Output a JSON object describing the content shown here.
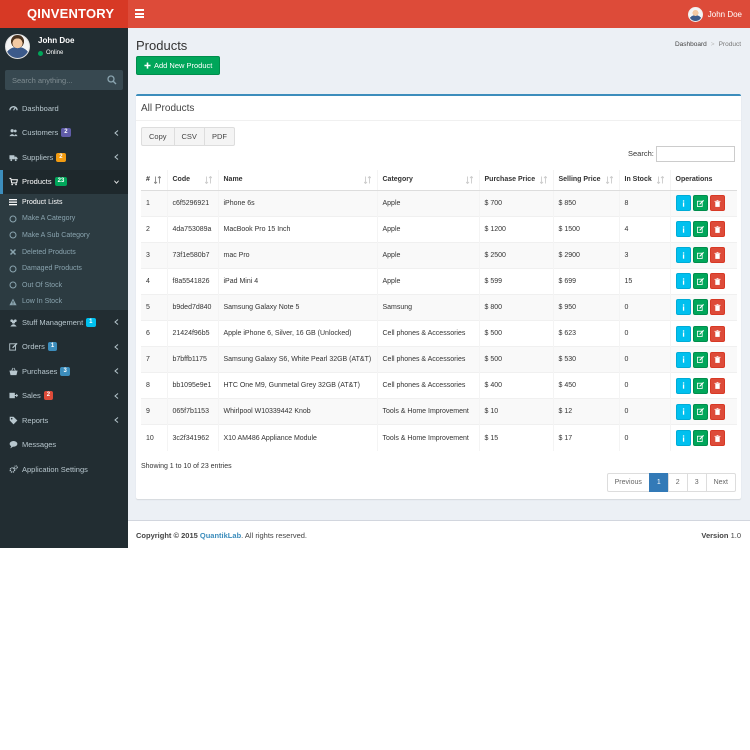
{
  "app": {
    "logo": "QINVENTORY",
    "user_name": "John Doe"
  },
  "sidebar": {
    "user": {
      "name": "John Doe",
      "status": "Online"
    },
    "search": {
      "placeholder": "Search anything..."
    },
    "menu": [
      {
        "label": "Dashboard",
        "icon": "dashboard-icon"
      },
      {
        "label": "Customers",
        "icon": "users-icon",
        "badge": "2",
        "badge_color": "#605ca8"
      },
      {
        "label": "Suppliers",
        "icon": "truck-icon",
        "badge": "2",
        "badge_color": "#f39c12"
      },
      {
        "label": "Products",
        "icon": "shopping-cart-icon",
        "badge": "23",
        "badge_color": "#00a65a"
      },
      {
        "label": "Stuff Management",
        "icon": "user-group-icon",
        "badge": "1",
        "badge_color": "#00c0ef"
      },
      {
        "label": "Orders",
        "icon": "edit-icon",
        "badge": "1",
        "badge_color": "#3c8dbc"
      },
      {
        "label": "Purchases",
        "icon": "basket-icon",
        "badge": "3",
        "badge_color": "#3c8dbc"
      },
      {
        "label": "Sales",
        "icon": "sales-icon",
        "badge": "2",
        "badge_color": "#dd4b39"
      },
      {
        "label": "Reports",
        "icon": "tag-icon"
      },
      {
        "label": "Messages",
        "icon": "chat-icon"
      },
      {
        "label": "Application Settings",
        "icon": "cogs-icon"
      }
    ],
    "submenu": [
      {
        "label": "Product Lists"
      },
      {
        "label": "Make A Category"
      },
      {
        "label": "Make A Sub Category"
      },
      {
        "label": "Deleted Products"
      },
      {
        "label": "Damaged Products"
      },
      {
        "label": "Out Of Stock"
      },
      {
        "label": "Low In Stock"
      }
    ]
  },
  "page": {
    "title": "Products",
    "breadcrumb": [
      "Dashboard",
      "Product"
    ],
    "add_button": "Add New Product"
  },
  "box": {
    "title": "All Products",
    "export_buttons": [
      "Copy",
      "CSV",
      "PDF"
    ],
    "search_label": "Search:"
  },
  "table": {
    "headers": [
      "#",
      "Code",
      "Name",
      "Category",
      "Purchase Price",
      "Selling Price",
      "In Stock",
      "Operations"
    ],
    "rows": [
      [
        "1",
        "c6f5296921",
        "iPhone 6s",
        "Apple",
        "$ 700",
        "$ 850",
        "8"
      ],
      [
        "2",
        "4da753089a",
        "MacBook Pro 15 Inch",
        "Apple",
        "$ 1200",
        "$ 1500",
        "4"
      ],
      [
        "3",
        "73f1e580b7",
        "mac Pro",
        "Apple",
        "$ 2500",
        "$ 2900",
        "3"
      ],
      [
        "4",
        "f8a5541826",
        "iPad Mini 4",
        "Apple",
        "$ 599",
        "$ 699",
        "15"
      ],
      [
        "5",
        "b9ded7d840",
        "Samsung Galaxy Note 5",
        "Samsung",
        "$ 800",
        "$ 950",
        "0"
      ],
      [
        "6",
        "21424f96b5",
        "Apple iPhone 6, Silver, 16 GB (Unlocked)",
        "Cell phones & Accessories",
        "$ 500",
        "$ 623",
        "0"
      ],
      [
        "7",
        "b7bffb1175",
        "Samsung Galaxy S6, White Pearl 32GB (AT&T)",
        "Cell phones & Accessories",
        "$ 500",
        "$ 530",
        "0"
      ],
      [
        "8",
        "bb1095e9e1",
        "HTC One M9, Gunmetal Grey 32GB (AT&T)",
        "Cell phones & Accessories",
        "$ 400",
        "$ 450",
        "0"
      ],
      [
        "9",
        "065f7b1153",
        "Whirlpool W10339442 Knob",
        "Tools & Home Improvement",
        "$ 10",
        "$ 12",
        "0"
      ],
      [
        "10",
        "3c2f341962",
        "X10 AM486 Appliance Module",
        "Tools & Home Improvement",
        "$ 15",
        "$ 17",
        "0"
      ]
    ]
  },
  "pagination": {
    "info": "Showing 1 to 10 of 23 entries",
    "previous": "Previous",
    "pages": [
      "1",
      "2",
      "3"
    ],
    "next": "Next",
    "active_page": "1"
  },
  "footer": {
    "copyright_prefix": "Copyright © 2015",
    "brand": "QuantikLab",
    "copyright_suffix": ". All rights reserved.",
    "version_label": "Version",
    "version": "1.0"
  },
  "colors": {
    "header_red": "#dd4b39",
    "logo_red": "#d73925",
    "sidebar_bg": "#222d32",
    "accent_blue": "#3c8dbc",
    "success_green": "#00a65a",
    "info_cyan": "#00c0ef"
  }
}
